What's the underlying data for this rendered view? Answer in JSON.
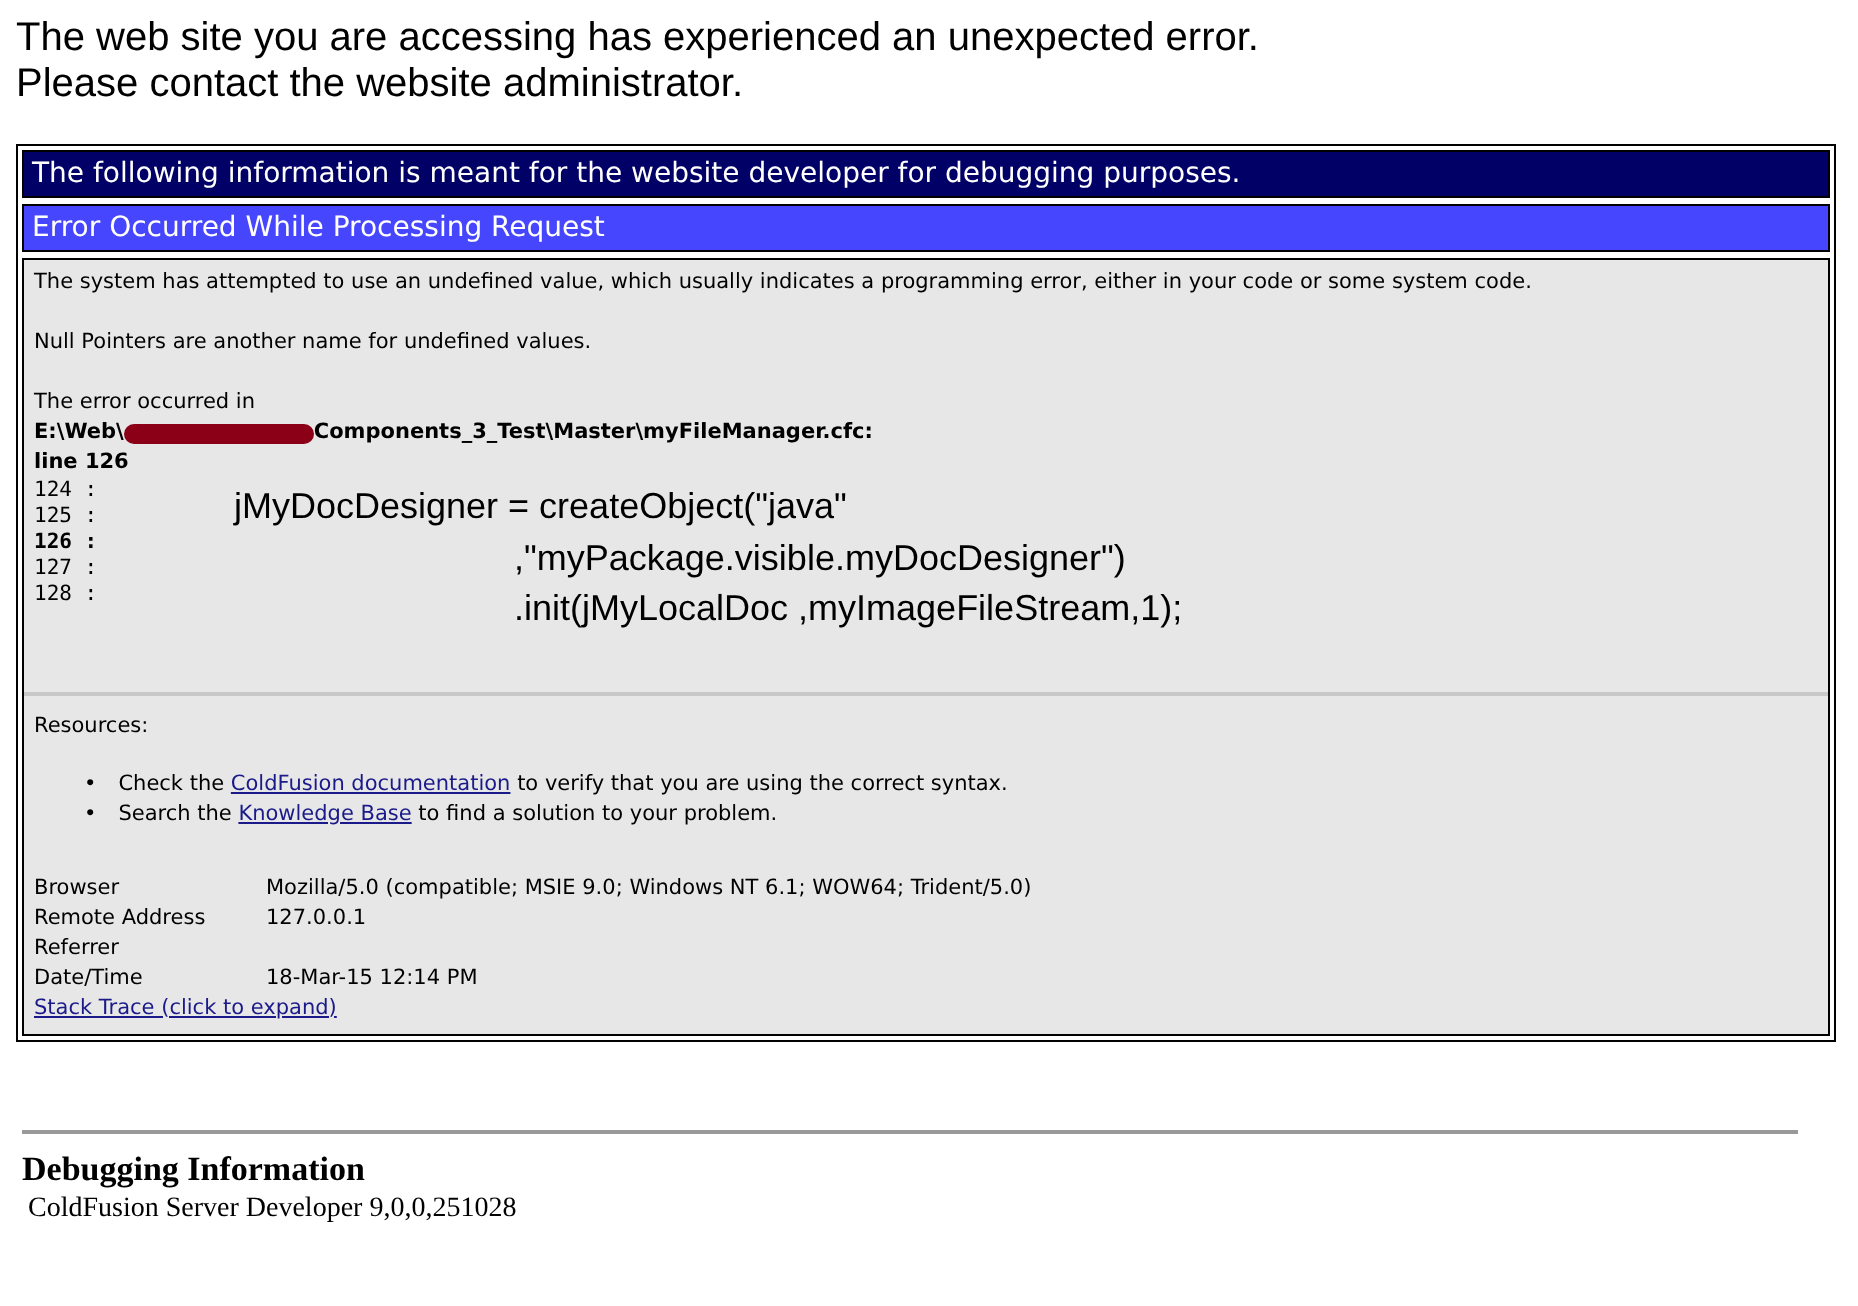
{
  "message": [
    "The web site you are accessing has experienced an unexpected error.",
    "Please contact the website administrator."
  ],
  "panel": {
    "title": "The following information is meant for the website developer for debugging purposes.",
    "subtitle": "Error Occurred While Processing Request",
    "description": "The system has attempted to use an undefined value, which usually indicates a programming error, either in your code or some system code.",
    "note": "Null Pointers are another name for undefined values.",
    "location_label": "The error occurred in",
    "path_start": "E:\\Web\\",
    "path_end": "Components_3_Test\\Master\\myFileManager.cfc:",
    "line_label": "line 126",
    "line_numbers": [
      {
        "text": "124 :",
        "highlighted": false
      },
      {
        "text": "125 :",
        "highlighted": false
      },
      {
        "text": "126 :",
        "highlighted": true
      },
      {
        "text": "127 :",
        "highlighted": false
      },
      {
        "text": "128 :",
        "highlighted": false
      }
    ],
    "code": [
      {
        "kind": "statement",
        "text": "jMyDocDesigner = createObject(\"java\""
      },
      {
        "kind": "continuation",
        "text": ",\"myPackage.visible.myDocDesigner\")"
      },
      {
        "kind": "continuation",
        "text": ".init(jMyLocalDoc ,myImageFileStream,1);"
      }
    ],
    "resources_label": "Resources:",
    "resources": [
      {
        "bullet": "•",
        "before": "Check the",
        "link": "ColdFusion documentation",
        "after": "to verify that you are using the correct syntax."
      },
      {
        "bullet": "•",
        "before": "Search the",
        "link": "Knowledge Base",
        "after": "to find a solution to your problem."
      }
    ],
    "info": [
      {
        "label": "Browser",
        "value": "Mozilla/5.0 (compatible; MSIE 9.0; Windows NT 6.1; WOW64; Trident/5.0)"
      },
      {
        "label": "Remote Address",
        "value": "127.0.0.1"
      },
      {
        "label": "Referrer"
      },
      {
        "label": "Date/Time",
        "value": "18-Mar-15 12:14 PM"
      }
    ],
    "stack_trace_link": "Stack Trace (click to expand)"
  },
  "debugging": {
    "title": "Debugging Information",
    "version": "ColdFusion Server Developer 9,0,0,251028"
  }
}
